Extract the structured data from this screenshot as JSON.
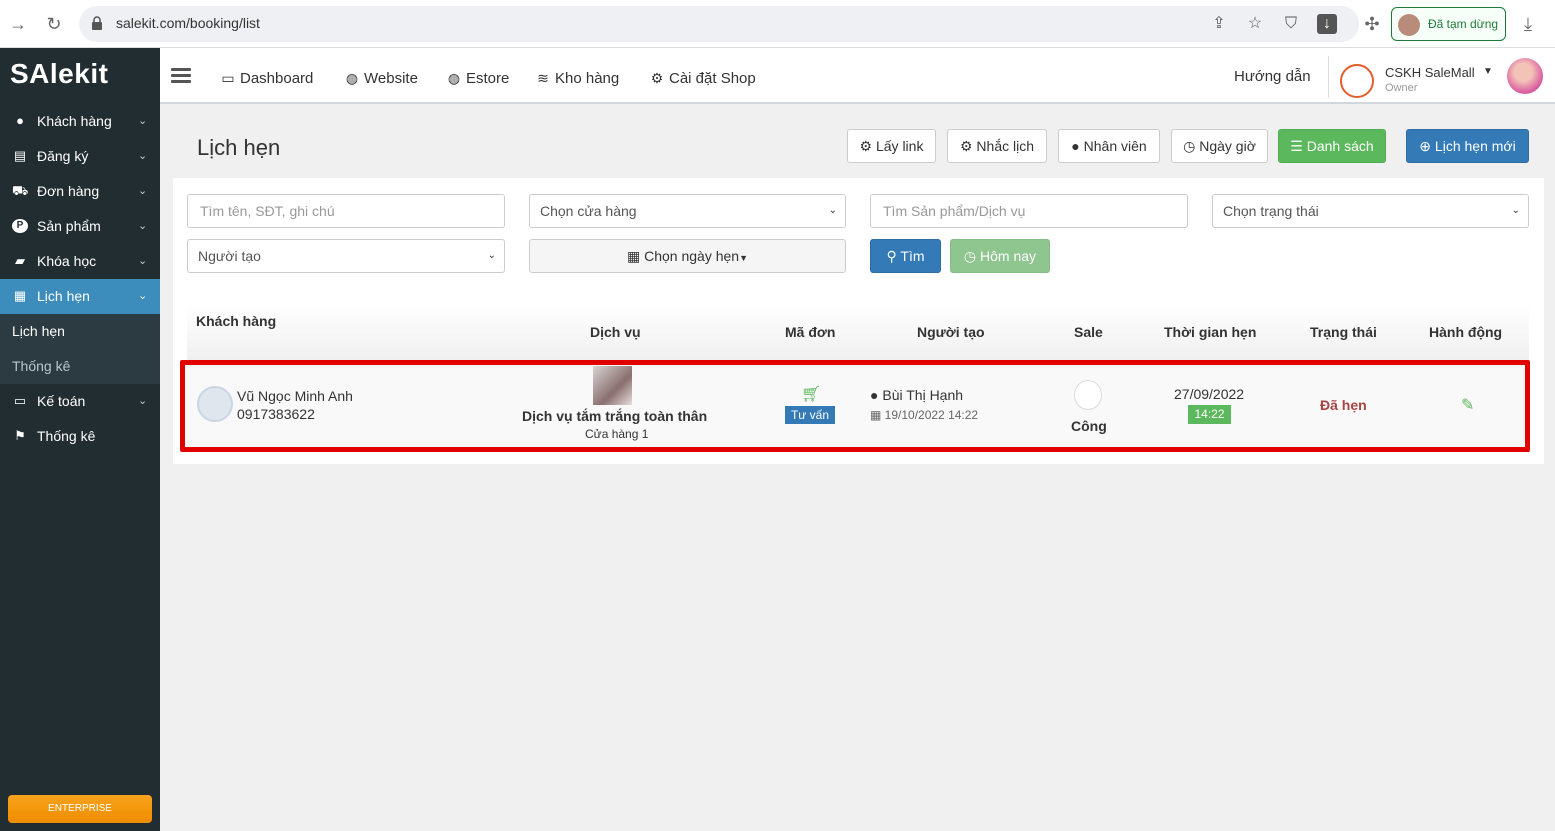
{
  "browser": {
    "url": "salekit.com/booking/list",
    "paused_label": "Đã tạm dừng"
  },
  "sidebar": {
    "logo": "SAlekit",
    "items": [
      {
        "label": "Khách hàng",
        "icon": "user-icon"
      },
      {
        "label": "Đăng ký",
        "icon": "card-icon"
      },
      {
        "label": "Đơn hàng",
        "icon": "cart-icon"
      },
      {
        "label": "Sản phẩm",
        "icon": "product-icon"
      },
      {
        "label": "Khóa học",
        "icon": "book-icon"
      },
      {
        "label": "Lịch hẹn",
        "icon": "calendar-icon"
      },
      {
        "label": "Kế toán",
        "icon": "credit-card-icon"
      },
      {
        "label": "Thống kê",
        "icon": "flag-icon"
      }
    ],
    "sub_items": [
      "Lịch hẹn",
      "Thống kê"
    ],
    "enterprise": "ENTERPRISE"
  },
  "topnav": {
    "items": [
      "Dashboard",
      "Website",
      "Estore",
      "Kho hàng",
      "Cài đặt Shop"
    ],
    "guide": "Hướng dẫn",
    "shop_name": "CSKH SaleMall",
    "role": "Owner"
  },
  "page": {
    "title": "Lịch hẹn",
    "buttons": {
      "get_link": "Lấy link",
      "reminder": "Nhắc lịch",
      "staff": "Nhân viên",
      "datetime": "Ngày giờ",
      "list": "Danh sách",
      "new": "Lịch hẹn mới"
    }
  },
  "filters": {
    "search_placeholder": "Tìm tên, SĐT, ghi chú",
    "store": "Chọn cửa hàng",
    "product_placeholder": "Tìm Sản phẩm/Dịch vụ",
    "status": "Chọn trạng thái",
    "creator": "Người tạo",
    "date": "Chọn ngày hẹn",
    "search_btn": "Tìm",
    "today_btn": "Hôm nay"
  },
  "table": {
    "headers": [
      "Khách hàng",
      "Dịch vụ",
      "Mã đơn",
      "Người tạo",
      "Sale",
      "Thời gian hẹn",
      "Trạng thái",
      "Hành động"
    ],
    "rows": [
      {
        "customer_name": "Vũ Ngọc Minh Anh",
        "customer_phone": "0917383622",
        "service": "Dịch vụ tắm trắng toàn thân",
        "store": "Cửa hàng 1",
        "order_badge": "Tư vấn",
        "creator": "Bùi Thị Hạnh",
        "created_at": "19/10/2022 14:22",
        "sale": "Công",
        "date": "27/09/2022",
        "time": "14:22",
        "status": "Đã hẹn",
        "status_color": "#a94442"
      }
    ]
  }
}
